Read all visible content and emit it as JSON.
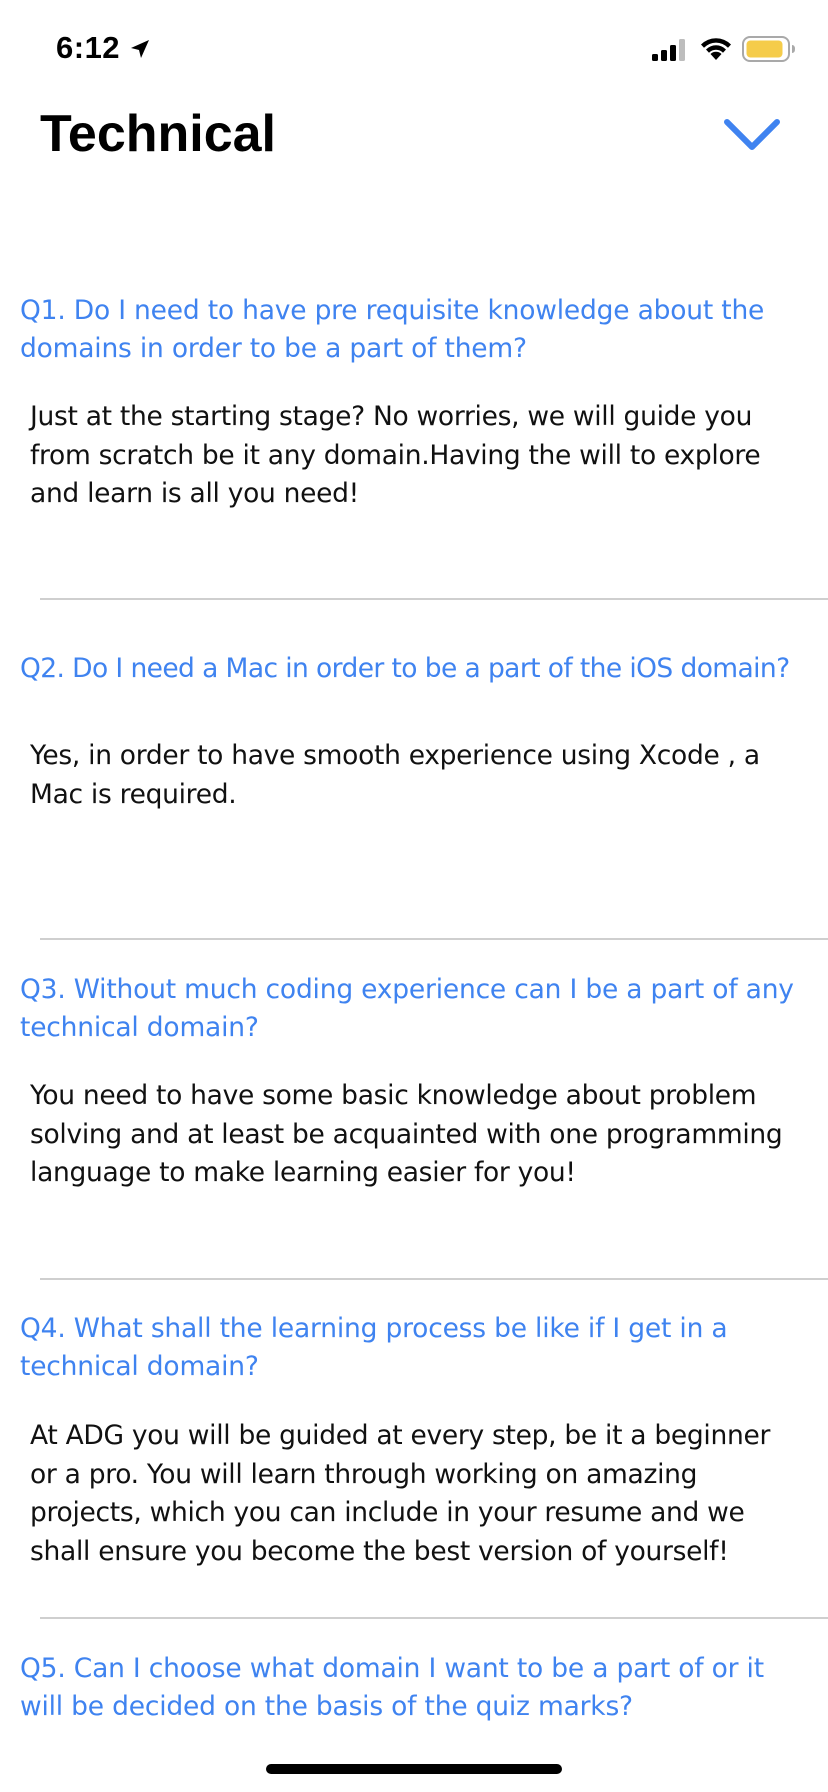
{
  "status_bar": {
    "time": "6:12",
    "battery_color": "#f5cc4a",
    "icons": [
      "location-arrow-icon",
      "cellular-signal-icon",
      "wifi-icon",
      "battery-icon"
    ]
  },
  "header": {
    "title": "Technical",
    "collapse_icon": "chevron-down-icon",
    "accent_color": "#3f83f0"
  },
  "faqs": [
    {
      "question": "Q1. Do I need to have pre requisite knowledge about the domains in order to be a part of them?",
      "answer": "Just at the starting stage? No worries, we will guide you from scratch be it any domain.Having the will to explore and learn is all you need!"
    },
    {
      "question": "Q2. Do I need a Mac in order to be a part of the iOS domain?",
      "answer": "Yes, in order to have smooth experience using Xcode , a Mac is required."
    },
    {
      "question": "Q3. Without much coding experience can I be a part of any technical domain?",
      "answer": "You need to have some basic knowledge about problem solving and at least be acquainted with one programming language to make learning easier for you!"
    },
    {
      "question": "Q4. What shall the learning process be like if I get in a technical domain?",
      "answer": "At ADG you will be guided at every step, be it a beginner or a pro. You will learn through working on amazing projects, which you can include in your resume and we shall ensure you become the best version of yourself!"
    },
    {
      "question": "Q5. Can I choose what domain I want to be a part of or it will be decided on the basis of the quiz marks?"
    }
  ]
}
